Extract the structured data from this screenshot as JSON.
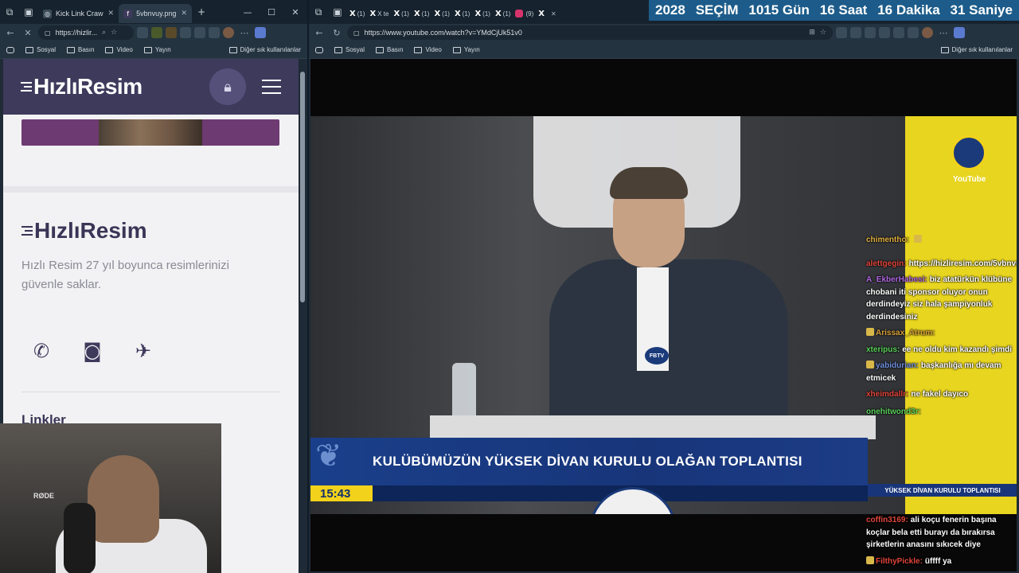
{
  "left_browser": {
    "tabs": [
      {
        "label": "Kick Link Craw",
        "active": false
      },
      {
        "label": "5vbnvuy.png",
        "active": true
      }
    ],
    "url": "https://hizlir...",
    "bookmarks": [
      "Sosyal",
      "Basın",
      "Video",
      "Yayın"
    ],
    "bookmarks_other": "Diğer sık kullanılanlar"
  },
  "right_browser": {
    "x_tabs": [
      "(1)",
      "X te",
      "(1)",
      "(1)",
      "(1)",
      "(1)",
      "(1)",
      "(1)"
    ],
    "ig_tab": "(9)",
    "url": "https://www.youtube.com/watch?v=YMdCjUk51v0",
    "bookmarks": [
      "Sosyal",
      "Basın",
      "Video",
      "Yayın"
    ],
    "bookmarks_other": "Diğer sık kullanılanlar"
  },
  "countdown": {
    "year": "2028",
    "label": "SEÇİM",
    "days": "1015 Gün",
    "hours": "16 Saat",
    "minutes": "16 Dakika",
    "seconds": "31 Saniye"
  },
  "hizliresim": {
    "logo": "HızlıResim",
    "logo_footer": "HızlıResim",
    "description": "Hızlı Resim 27 yıl boyunca resimlerinizi güvenle saklar.",
    "links_heading": "Linkler",
    "social_icons": [
      "whatsapp-icon",
      "instagram-icon",
      "twitter-icon"
    ]
  },
  "webcam": {
    "mic_label": "RØDE"
  },
  "video": {
    "lower_third_title": "KULÜBÜMÜZÜN YÜKSEK DİVAN KURULU OLAĞAN TOPLANTISI",
    "time": "15:43",
    "channel_tag": "YouTube",
    "mini_bar": "YÜKSEK DİVAN KURULU TOPLANTISI",
    "podium_text": "FBTV"
  },
  "chat": [
    {
      "user": "chimentho:",
      "color": "#e0b040",
      "text": ""
    },
    {
      "user": "alettgegin:",
      "color": "#e0453a",
      "text": "https://hizliresim.com/5vbnvuy"
    },
    {
      "user": "A_EkberHabesi:",
      "color": "#b066e0",
      "text": "biz atatürkün klübüne chobani iti sponsor oluyor onun derdindeyiz siz hala şampiyonluk derdindesiniz"
    },
    {
      "user": "Arissax_Atrum:",
      "color": "#d9a03a",
      "text": ""
    },
    {
      "user": "xteripus:",
      "color": "#5ad15a",
      "text": "ee ne oldu kim kazandı şimdi"
    },
    {
      "user": "yabidurian:",
      "color": "#6f8fe0",
      "text": "başkanlığa mı devam etmicek"
    },
    {
      "user": "xheimdallr:",
      "color": "#e0453a",
      "text": "ne fakel dayıco"
    },
    {
      "user": "onehitwond3r:",
      "color": "#5ad15a",
      "text": ""
    },
    {
      "user": "coffin3169:",
      "color": "#e0453a",
      "text": "ali koçu fenerin başına koçlar bela etti burayı da bırakırsa şirketlerin anasını sıkıcek diye"
    },
    {
      "user": "FilthyPickle:",
      "color": "#e0453a",
      "text": "üffff ya"
    }
  ]
}
